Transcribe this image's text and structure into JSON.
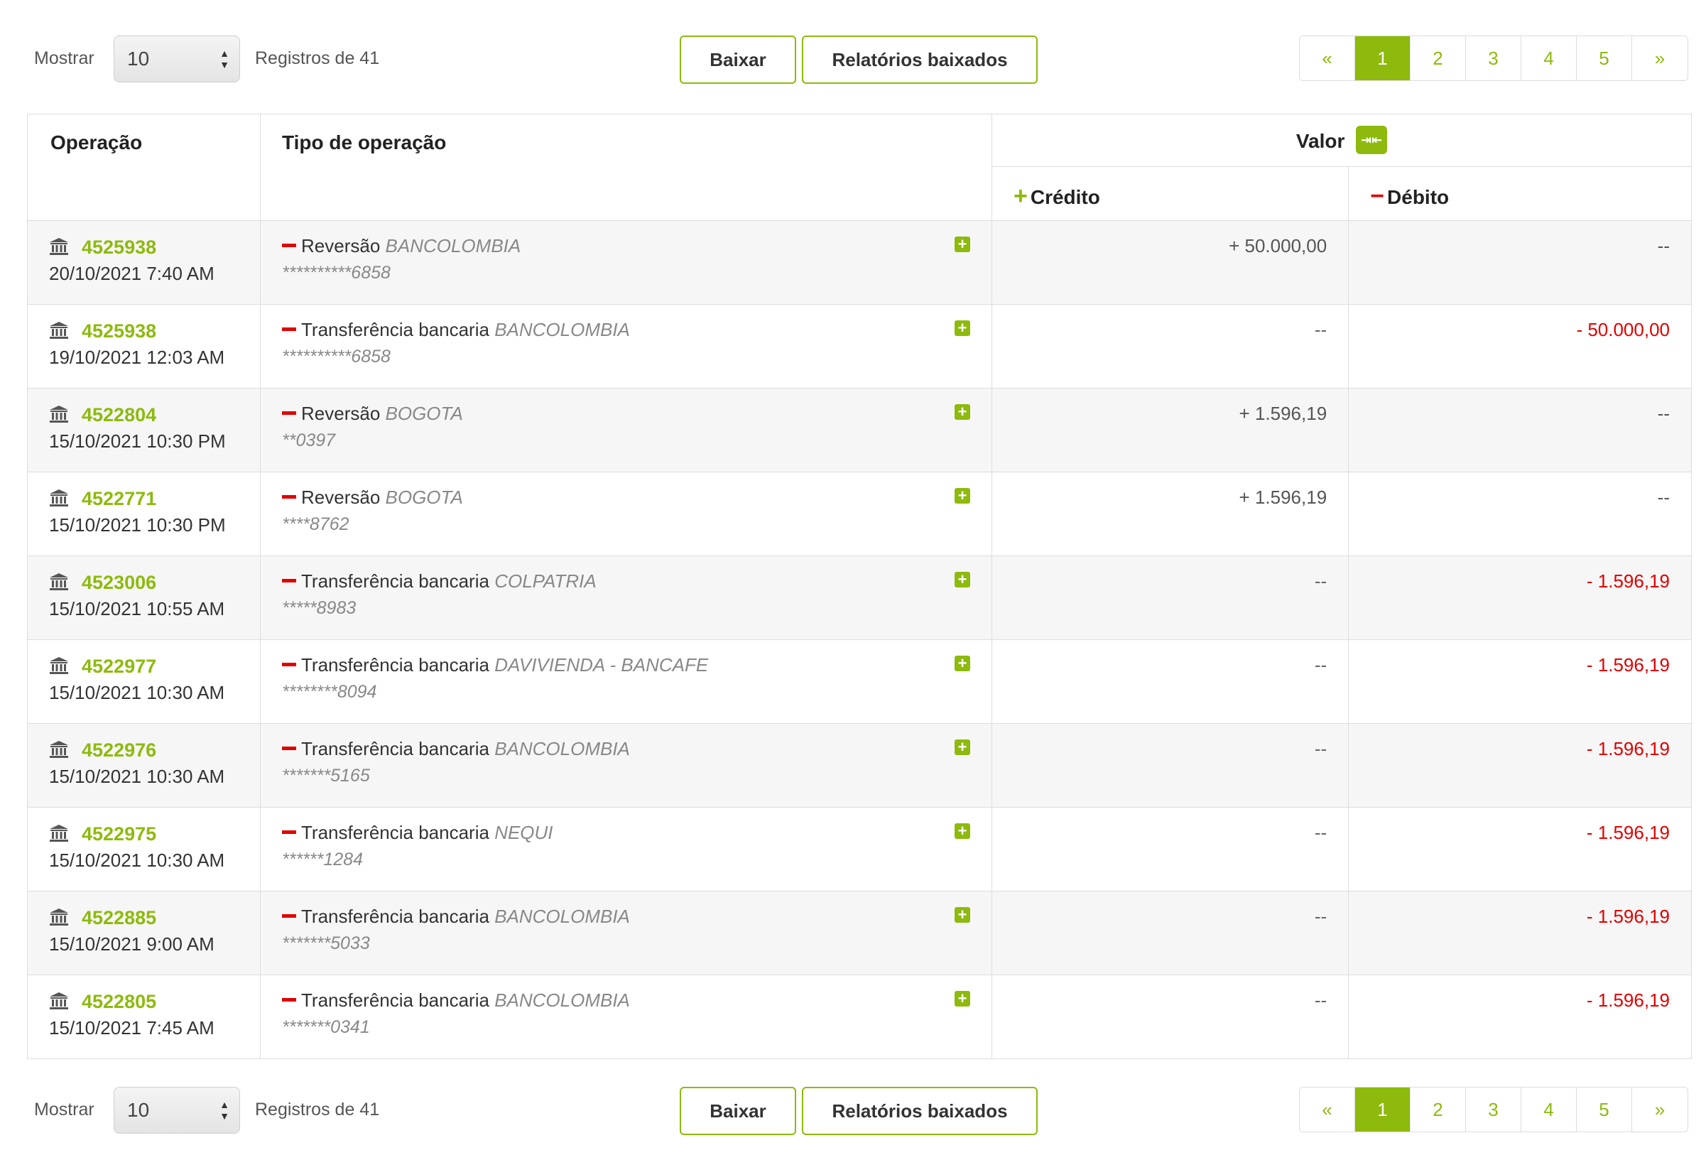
{
  "controls": {
    "show_label": "Mostrar",
    "page_size": "10",
    "records_label": "Registros de 41",
    "download_button": "Baixar",
    "reports_button": "Relatórios baixados",
    "pagination": [
      "«",
      "1",
      "2",
      "3",
      "4",
      "5",
      "»"
    ],
    "active_page": "1"
  },
  "table": {
    "headers": {
      "operation": "Operação",
      "operation_type": "Tipo de operação",
      "value": "Valor",
      "credit": "Crédito",
      "debit": "Débito"
    },
    "rows": [
      {
        "id": "4525938",
        "date": "20/10/2021 7:40 AM",
        "type": "Reversão",
        "bank": "BANCOLOMBIA",
        "account": "**********6858",
        "credit": "+ 50.000,00",
        "debit": "--"
      },
      {
        "id": "4525938",
        "date": "19/10/2021 12:03 AM",
        "type": "Transferência bancaria",
        "bank": "BANCOLOMBIA",
        "account": "**********6858",
        "credit": "--",
        "debit": "- 50.000,00"
      },
      {
        "id": "4522804",
        "date": "15/10/2021 10:30 PM",
        "type": "Reversão",
        "bank": "BOGOTA",
        "account": "**0397",
        "credit": "+ 1.596,19",
        "debit": "--"
      },
      {
        "id": "4522771",
        "date": "15/10/2021 10:30 PM",
        "type": "Reversão",
        "bank": "BOGOTA",
        "account": "****8762",
        "credit": "+ 1.596,19",
        "debit": "--"
      },
      {
        "id": "4523006",
        "date": "15/10/2021 10:55 AM",
        "type": "Transferência bancaria",
        "bank": "COLPATRIA",
        "account": "*****8983",
        "credit": "--",
        "debit": "- 1.596,19"
      },
      {
        "id": "4522977",
        "date": "15/10/2021 10:30 AM",
        "type": "Transferência bancaria",
        "bank": "DAVIVIENDA - BANCAFE",
        "account": "********8094",
        "credit": "--",
        "debit": "- 1.596,19"
      },
      {
        "id": "4522976",
        "date": "15/10/2021 10:30 AM",
        "type": "Transferência bancaria",
        "bank": "BANCOLOMBIA",
        "account": "*******5165",
        "credit": "--",
        "debit": "- 1.596,19"
      },
      {
        "id": "4522975",
        "date": "15/10/2021 10:30 AM",
        "type": "Transferência bancaria",
        "bank": "NEQUI",
        "account": "******1284",
        "credit": "--",
        "debit": "- 1.596,19"
      },
      {
        "id": "4522885",
        "date": "15/10/2021 9:00 AM",
        "type": "Transferência bancaria",
        "bank": "BANCOLOMBIA",
        "account": "*******5033",
        "credit": "--",
        "debit": "- 1.596,19"
      },
      {
        "id": "4522805",
        "date": "15/10/2021 7:45 AM",
        "type": "Transferência bancaria",
        "bank": "BANCOLOMBIA",
        "account": "*******0341",
        "credit": "--",
        "debit": "- 1.596,19"
      }
    ]
  },
  "icons": {
    "row_icon": "bank-icon",
    "expand_icon": "plus-square-icon",
    "value_toggle_icon": "swap-icon"
  },
  "colors": {
    "accent": "#8dba0c",
    "negative": "#e00000"
  }
}
